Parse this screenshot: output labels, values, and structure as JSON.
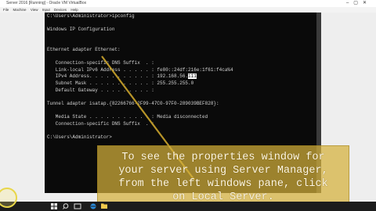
{
  "window": {
    "title": "Server 2016 [Running] - Oracle VM VirtualBox"
  },
  "menu": [
    "File",
    "Machine",
    "View",
    "Input",
    "Devices",
    "Help"
  ],
  "console": {
    "lines": [
      "C:\\Users\\Administrator>ipconfig",
      "",
      "Windows IP Configuration",
      "",
      "",
      "Ethernet adapter Ethernet:",
      "",
      "   Connection-specific DNS Suffix  . :",
      "   Link-local IPv6 Address . . . . . : fe80::24df:216e:1f61:f4ca%4",
      "   IPv4 Address. . . . . . . . . . . : 192.168.56.",
      "   Subnet Mask . . . . . . . . . . . : 255.255.255.0",
      "   Default Gateway . . . . . . . . . :",
      "",
      "Tunnel adapter isatap.{82266766-2F99-47C0-97F0-289039BEF828}:",
      "",
      "   Media State . . . . . . . . . . . : Media disconnected",
      "   Connection-specific DNS Suffix  . :",
      "",
      "C:\\Users\\Administrator>"
    ],
    "selected_text": "111"
  },
  "caption": {
    "lines": [
      "To see the properties window for",
      "your server using Server Manager,",
      "from the left windows pane, click",
      "on Local Server."
    ]
  },
  "colors": {
    "caption_bg": "#d6b23c",
    "console_bg": "#0a0a0a",
    "taskbar_bg": "#1c1c1c"
  }
}
